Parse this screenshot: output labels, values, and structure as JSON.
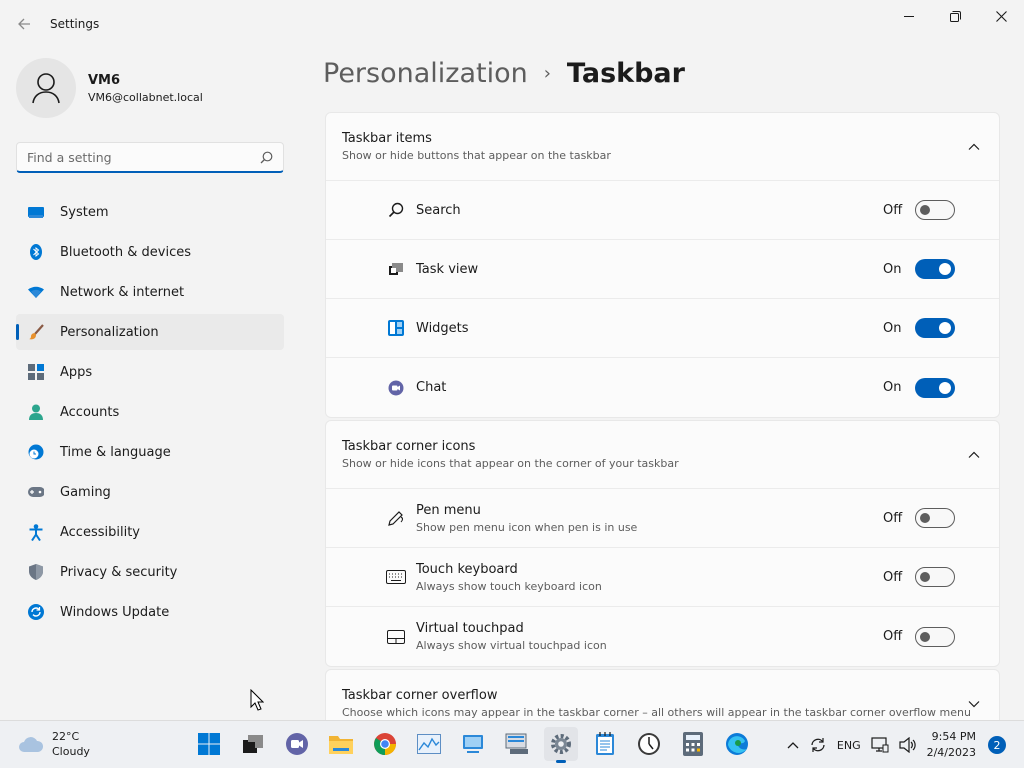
{
  "window": {
    "title": "Settings"
  },
  "profile": {
    "name": "VM6",
    "email": "VM6@collabnet.local"
  },
  "search": {
    "placeholder": "Find a setting"
  },
  "nav": {
    "items": [
      {
        "label": "System",
        "icon": "system-icon"
      },
      {
        "label": "Bluetooth & devices",
        "icon": "bluetooth-icon"
      },
      {
        "label": "Network & internet",
        "icon": "wifi-icon"
      },
      {
        "label": "Personalization",
        "icon": "brush-icon",
        "active": true
      },
      {
        "label": "Apps",
        "icon": "apps-icon"
      },
      {
        "label": "Accounts",
        "icon": "accounts-icon"
      },
      {
        "label": "Time & language",
        "icon": "globe-clock-icon"
      },
      {
        "label": "Gaming",
        "icon": "gamepad-icon"
      },
      {
        "label": "Accessibility",
        "icon": "accessibility-icon"
      },
      {
        "label": "Privacy & security",
        "icon": "shield-icon"
      },
      {
        "label": "Windows Update",
        "icon": "update-icon"
      }
    ]
  },
  "breadcrumb": {
    "parent": "Personalization",
    "separator": "›",
    "current": "Taskbar"
  },
  "groups": {
    "taskbar_items": {
      "title": "Taskbar items",
      "subtitle": "Show or hide buttons that appear on the taskbar",
      "rows": [
        {
          "label": "Search",
          "state": "Off",
          "on": false,
          "icon": "search-icon"
        },
        {
          "label": "Task view",
          "state": "On",
          "on": true,
          "icon": "task-view-icon"
        },
        {
          "label": "Widgets",
          "state": "On",
          "on": true,
          "icon": "widgets-icon"
        },
        {
          "label": "Chat",
          "state": "On",
          "on": true,
          "icon": "chat-icon"
        }
      ]
    },
    "corner_icons": {
      "title": "Taskbar corner icons",
      "subtitle": "Show or hide icons that appear on the corner of your taskbar",
      "rows": [
        {
          "label": "Pen menu",
          "sub": "Show pen menu icon when pen is in use",
          "state": "Off",
          "on": false,
          "icon": "pen-icon"
        },
        {
          "label": "Touch keyboard",
          "sub": "Always show touch keyboard icon",
          "state": "Off",
          "on": false,
          "icon": "keyboard-icon"
        },
        {
          "label": "Virtual touchpad",
          "sub": "Always show virtual touchpad icon",
          "state": "Off",
          "on": false,
          "icon": "touchpad-icon"
        }
      ]
    },
    "corner_overflow": {
      "title": "Taskbar corner overflow",
      "subtitle": "Choose which icons may appear in the taskbar corner – all others will appear in the taskbar corner overflow menu"
    }
  },
  "taskbar": {
    "weather": {
      "temp": "22°C",
      "condition": "Cloudy"
    },
    "tray": {
      "language": "ENG"
    },
    "clock": {
      "time": "9:54 PM",
      "date": "2/4/2023"
    },
    "notification_count": "2"
  },
  "colors": {
    "accent": "#005fb8",
    "background": "#f3f3f3",
    "card": "#fbfbfb"
  }
}
